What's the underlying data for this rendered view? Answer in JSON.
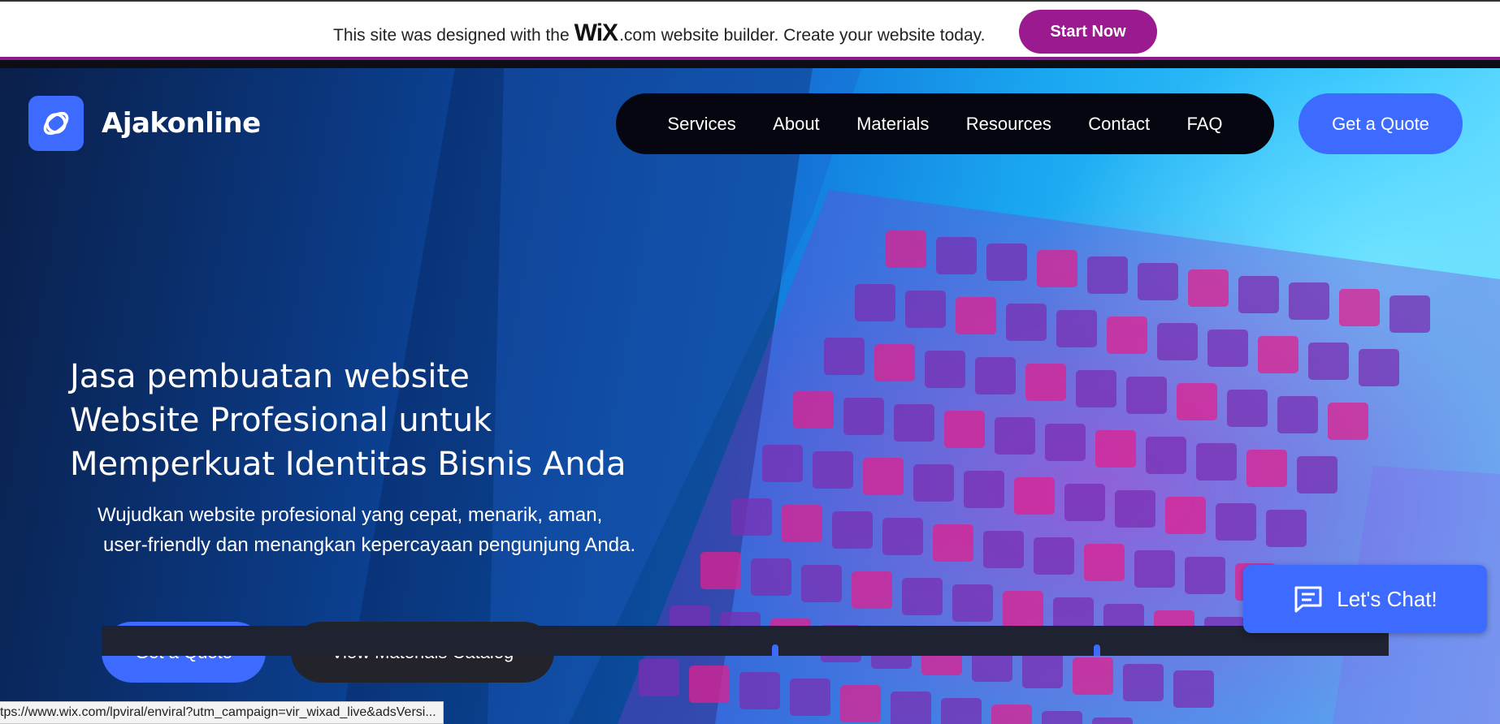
{
  "wix_banner": {
    "text_before": "This site was designed with the",
    "logo_text": "WiX",
    "text_after_logo": ".com",
    "text_after": "website builder. Create your website today.",
    "cta_label": "Start Now",
    "accent_color": "#9b1a8f"
  },
  "header": {
    "brand_name": "Ajakonline",
    "logo_icon": "orbit-logo-icon",
    "nav": [
      "Services",
      "About",
      "Materials",
      "Resources",
      "Contact",
      "FAQ"
    ],
    "quote_label": "Get a Quote"
  },
  "hero": {
    "headline_lines": [
      "Jasa pembuatan website",
      "Website Profesional untuk",
      "Memperkuat Identitas Bisnis Anda"
    ],
    "subtext_lines": [
      "Wujudkan website profesional yang cepat, menarik, aman,",
      "user-friendly dan menangkan kepercayaan pengunjung Anda."
    ],
    "primary_cta": "Get a Quote",
    "secondary_cta": "View Materials Catalog"
  },
  "chat": {
    "label": "Let's Chat!",
    "icon": "chat-bubble-icon"
  },
  "status_bar": {
    "url": "tps://www.wix.com/lpviral/enviral?utm_campaign=vir_wixad_live&adsVersi..."
  },
  "colors": {
    "brand_blue": "#3d6bff",
    "nav_bg": "#05060f",
    "dark_button": "#22232b"
  }
}
